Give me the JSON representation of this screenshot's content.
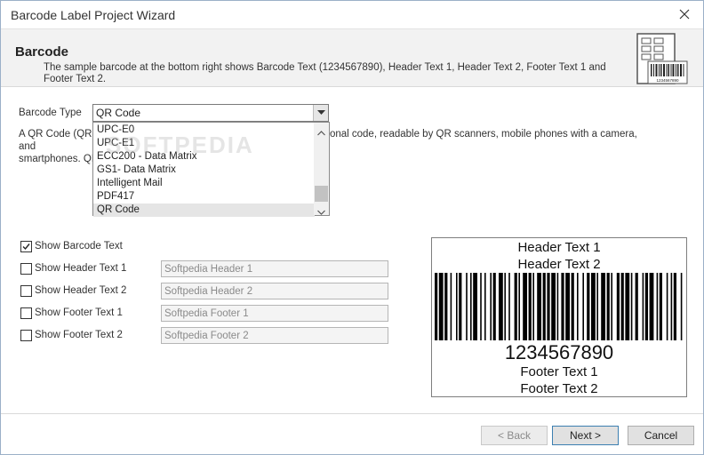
{
  "window": {
    "title": "Barcode Label Project Wizard"
  },
  "header": {
    "title": "Barcode",
    "description": "The sample barcode at the bottom right shows Barcode Text (1234567890), Header Text 1, Header Text 2, Footer Text 1 and Footer Text 2.",
    "icon": "barcode-label-icon",
    "icon_number": "1234567890"
  },
  "barcode_type": {
    "label": "Barcode Type",
    "value": "QR Code",
    "options_visible": [
      "UPC-E0",
      "UPC-E1",
      "ECC200 - Data Matrix",
      "GS1- Data Matrix",
      "Intelligent Mail",
      "PDF417",
      "QR Code"
    ],
    "selected_index": 6
  },
  "description": {
    "line1_start": "A QR Code (QR is",
    "line1_end": "onal code, readable by QR scanners, mobile phones with a camera, and",
    "line2": "smartphones. QR"
  },
  "watermark": "SOFTPEDIA",
  "options": [
    {
      "label": "Show Barcode Text",
      "checked": true
    },
    {
      "label": "Show Header Text 1",
      "checked": false,
      "placeholder": "Softpedia Header 1"
    },
    {
      "label": "Show Header Text 2",
      "checked": false,
      "placeholder": "Softpedia Header 2"
    },
    {
      "label": "Show Footer Text 1",
      "checked": false,
      "placeholder": "Softpedia Footer 1"
    },
    {
      "label": "Show Footer Text 2",
      "checked": false,
      "placeholder": "Softpedia Footer 2"
    }
  ],
  "preview": {
    "header1": "Header Text 1",
    "header2": "Header Text 2",
    "barcode_text": "1234567890",
    "footer1": "Footer Text 1",
    "footer2": "Footer Text 2"
  },
  "buttons": {
    "back": "< Back",
    "next": "Next >",
    "cancel": "Cancel"
  }
}
